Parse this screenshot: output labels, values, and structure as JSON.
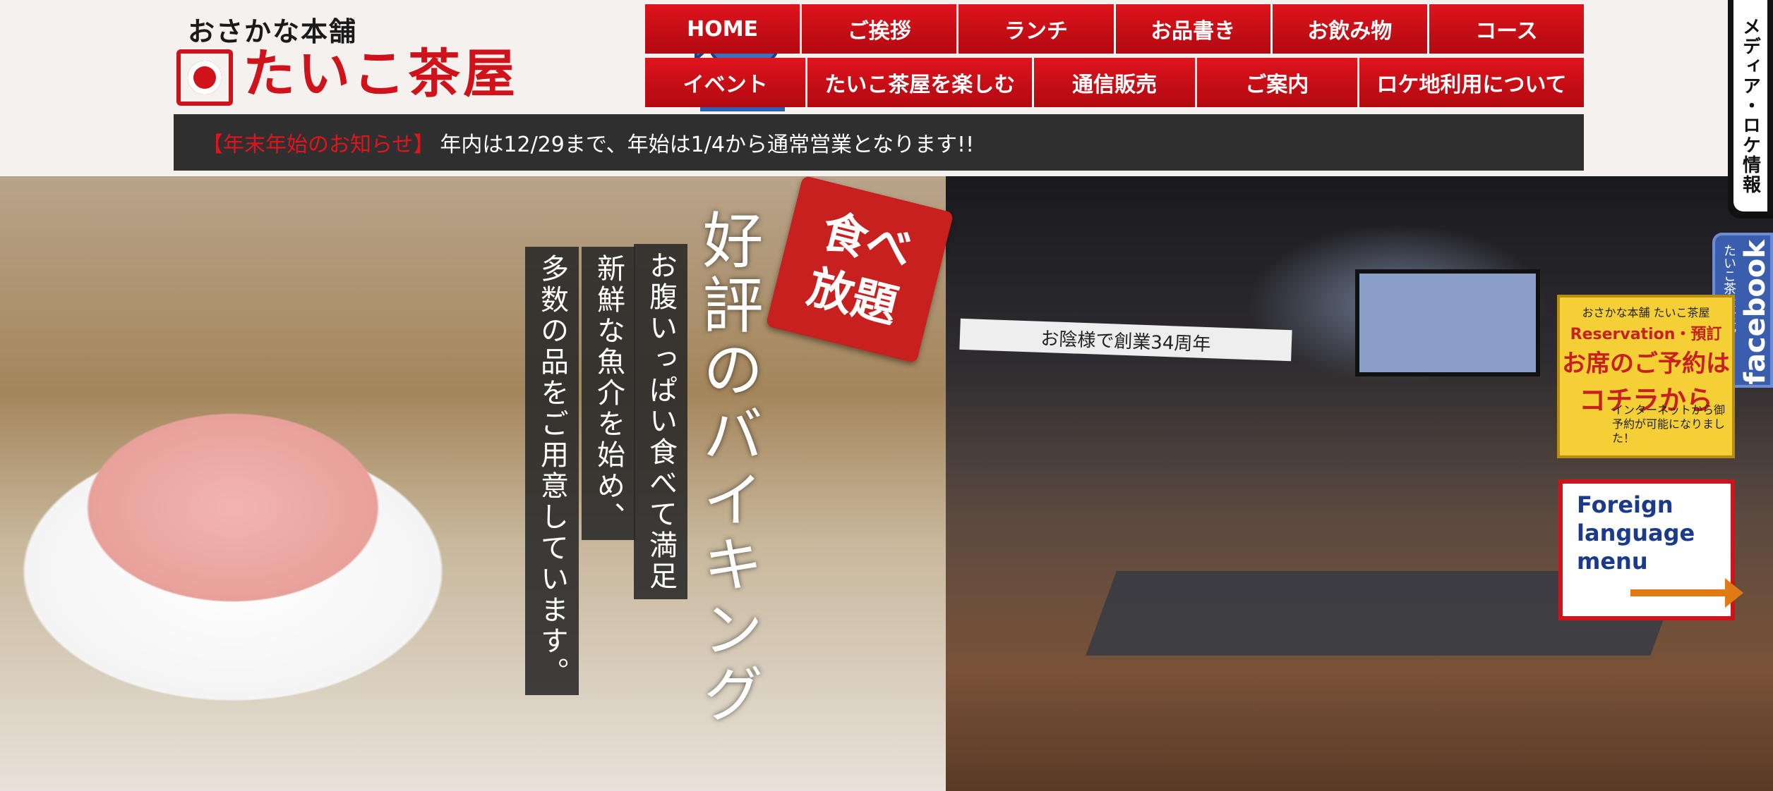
{
  "logo": {
    "tagline": "おさかな本舗",
    "name": "たいこ茶屋"
  },
  "nav": {
    "row1": [
      "HOME",
      "ご挨拶",
      "ランチ",
      "お品書き",
      "お飲み物",
      "コース"
    ],
    "row2": [
      "イベント",
      "たいこ茶屋を楽しむ",
      "通信販売",
      "ご案内",
      "ロケ地利用について"
    ]
  },
  "notice": {
    "tag": "【年末年始のお知らせ】",
    "text": "年内は12/29まで、年始は1/4から通常営業となります!!"
  },
  "side": {
    "media": "メディア・ロケ情報",
    "facebook_small": "たいこ茶屋公式",
    "facebook_big": "facebook"
  },
  "hero": {
    "badge_line1": "食べ",
    "badge_line2": "放題",
    "catch": "好評のバイキング",
    "line1": "お腹いっぱい食べて満足",
    "line2": "新鮮な魚介を始め、",
    "line3": "多数の品をご用意しています。",
    "banner": "お陰様で創業34周年"
  },
  "reservation": {
    "brand": "おさかな本舗 たいこ茶屋",
    "title": "Reservation・預訂",
    "line1": "お席のご予約は",
    "line2": "コチラから",
    "note": "インターネットから御予約が可能になりました！"
  },
  "foreign": {
    "label": "Foreign language menu"
  },
  "colors": {
    "brand_red": "#d0121b",
    "notice_bg": "#2f2f2f",
    "facebook_blue": "#3a5dae",
    "reserve_yellow": "#f4cf36"
  }
}
